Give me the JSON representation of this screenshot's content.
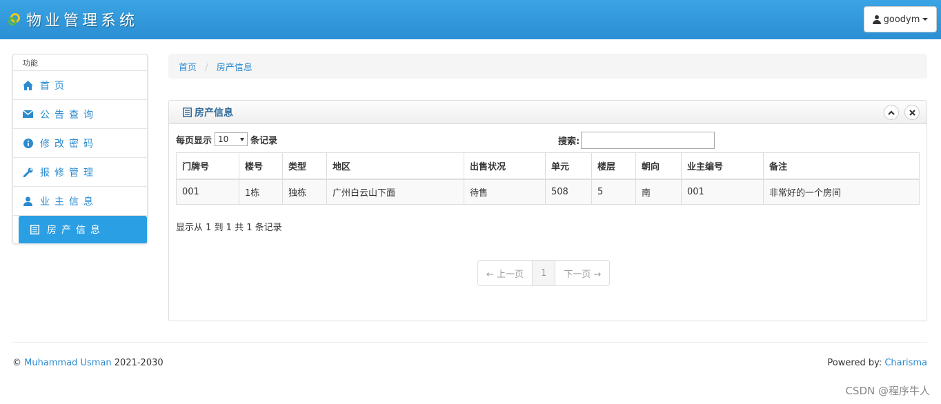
{
  "header": {
    "app_title": "物业管理系统",
    "user_label": "goodym"
  },
  "sidebar": {
    "heading": "功能",
    "items": [
      {
        "label": "首页",
        "icon": "home-icon"
      },
      {
        "label": "公告查询",
        "icon": "envelope-icon"
      },
      {
        "label": "修改密码",
        "icon": "info-icon"
      },
      {
        "label": "报修管理",
        "icon": "wrench-icon"
      },
      {
        "label": "业主信息",
        "icon": "user-icon"
      },
      {
        "label": "房产信息",
        "icon": "list-icon",
        "active": true
      }
    ]
  },
  "breadcrumb": {
    "home": "首页",
    "separator": "/",
    "current": "房产信息"
  },
  "panel": {
    "title": "房产信息",
    "length_prefix": "每页显示",
    "length_value": "10",
    "length_suffix": "条记录",
    "search_label": "搜索:",
    "search_value": ""
  },
  "table": {
    "columns": [
      "门牌号",
      "楼号",
      "类型",
      "地区",
      "出售状况",
      "单元",
      "楼层",
      "朝向",
      "业主编号",
      "备注"
    ],
    "rows": [
      [
        "001",
        "1栋",
        "独栋",
        "广州白云山下面",
        "待售",
        "508",
        "5",
        "南",
        "001",
        "非常好的一个房间"
      ]
    ]
  },
  "info_text": "显示从 1 到 1 共 1 条记录",
  "pagination": {
    "prev": "← 上一页",
    "current": "1",
    "next": "下一页 →"
  },
  "footer": {
    "copyright_symbol": "©",
    "author": "Muhammad Usman",
    "years": "2021-2030",
    "powered_label": "Powered by:",
    "powered_link": "Charisma"
  },
  "watermark": "CSDN @程序牛人",
  "colors": {
    "header_blue": "#2b9fe3",
    "link_blue": "#2a8bd0"
  }
}
